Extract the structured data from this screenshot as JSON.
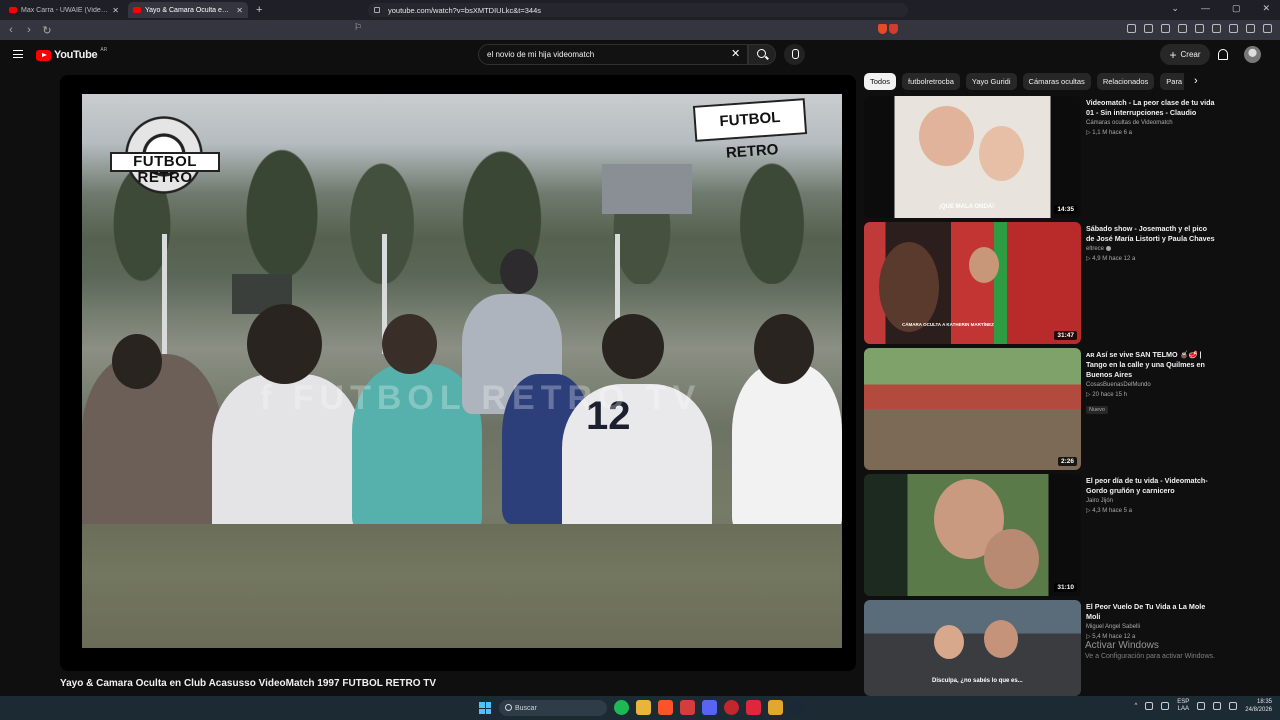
{
  "browser": {
    "tabs": [
      {
        "title": "Max Carra - UWAIE (Video Oficial) - Y",
        "active": false
      },
      {
        "title": "Yayo & Camara Oculta en Clu",
        "active": true
      }
    ],
    "new_tab": "+",
    "window_controls": [
      "⌄",
      "—",
      "▢",
      "✕"
    ],
    "url": "youtube.com/watch?v=bsXMTDIULkc&t=344s"
  },
  "youtube": {
    "logo_text": "YouTube",
    "country": "AR",
    "search_value": "el novio de mi hija videomatch",
    "create_label": "Crear",
    "colors": {
      "brand_red": "#ff0000",
      "bg": "#0f0f0f"
    }
  },
  "player": {
    "logo_left": "FUTBOL RETRO",
    "logo_right": "FUTBOL RETRO",
    "watermark": "f FUTBOL RETRO TV",
    "jersey_number": "12",
    "video_title": "Yayo & Camara Oculta en Club Acasusso VideoMatch 1997 FUTBOL RETRO TV"
  },
  "chips": [
    "Todos",
    "futbolretrocba",
    "Yayo Guridi",
    "Cámaras ocultas",
    "Relacionados",
    "Para ti",
    "S"
  ],
  "recommendations": [
    {
      "title": "Videomatch - La peor clase de tu vida 01 - Sin interrupciones - Claudio",
      "channel": "Cámaras ocultas de Videomatch",
      "stats": "▷ 1,1 M   hace 6 a",
      "duration": "14:35",
      "caption": "¡QUE MALA ONDA!",
      "badge": ""
    },
    {
      "title": "Sábado show - Josemacth y el pico de José María Listorti y Paula Chaves",
      "channel": "eltrece",
      "stats": "▷ 4,9 M   hace 12 a",
      "duration": "31:47",
      "caption": "CÁMARA OCULTA A KATHERIN MARTÍNEZ",
      "badge": ""
    },
    {
      "title": "ᴀʀ Así se vive SAN TELMO 🧉🥩 | Tango en la calle y una Quilmes en Buenos Aires",
      "channel": "CosasBuenasDelMundo",
      "stats": "▷ 20   hace 15 h",
      "duration": "2:26",
      "caption": "",
      "badge": "Nuevo"
    },
    {
      "title": "El peor día de tu vida - Videomatch- Gordo gruñón y carnicero",
      "channel": "Jairo Jijón",
      "stats": "▷ 4,3 M   hace 5 a",
      "duration": "31:10",
      "caption": "",
      "badge": ""
    },
    {
      "title": "El Peor Vuelo De Tu Vida a La Mole Moli",
      "channel": "Miguel Angel Sabelli",
      "stats": "▷ 5,4 M   hace 12 a",
      "duration": "",
      "caption": "Disculpa, ¿no sabés lo que es...",
      "badge": ""
    }
  ],
  "activate_windows": {
    "title": "Activar Windows",
    "subtitle": "Ve a Configuración para activar Windows."
  },
  "taskbar": {
    "search_placeholder": "Buscar",
    "lang_line1": "ESP",
    "lang_line2": "LAA",
    "time": "18:35",
    "date": "24/8/2026",
    "tray_arrow": "^"
  }
}
